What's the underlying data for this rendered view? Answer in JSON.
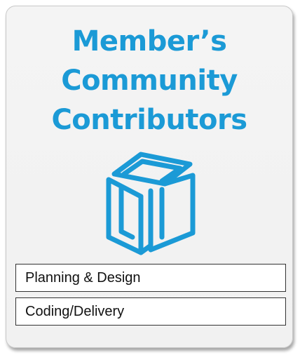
{
  "card": {
    "title_lines": [
      "Member’s",
      "Community",
      "Contributors"
    ],
    "logo_icon": "stacked-boxes-icon",
    "accent_color": "#1b9ad6",
    "items": [
      {
        "label": "Planning & Design"
      },
      {
        "label": "Coding/Delivery"
      }
    ]
  }
}
